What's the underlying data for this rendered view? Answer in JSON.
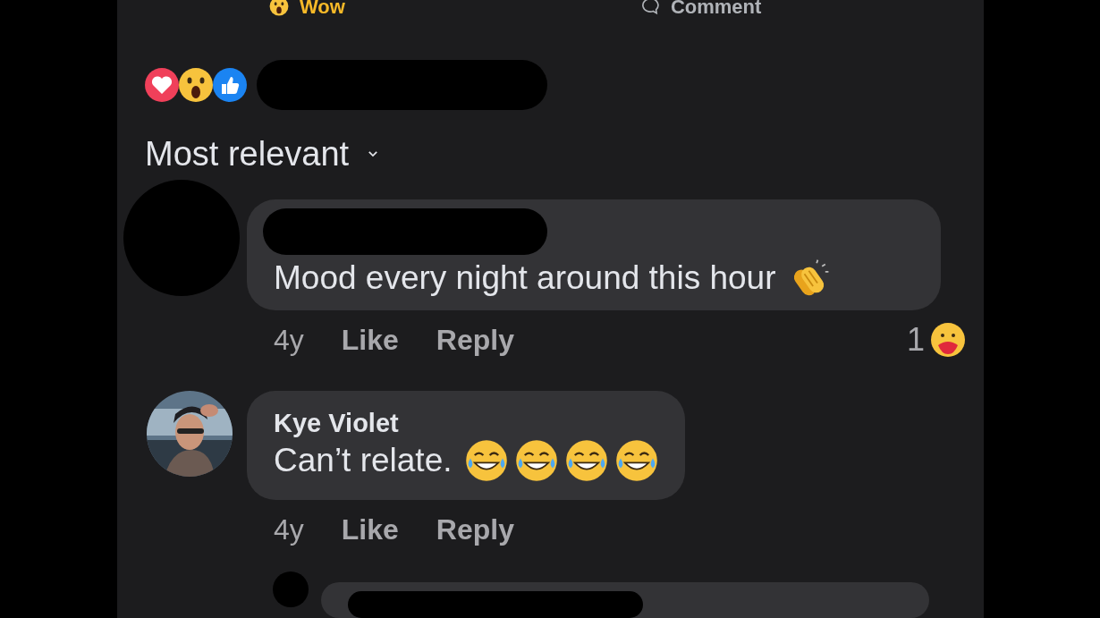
{
  "action_bar": [
    {
      "label": "Wow",
      "kind": "wow",
      "selected": true
    },
    {
      "label": "Comment",
      "kind": "comment",
      "selected": false
    }
  ],
  "reaction_summary": {
    "reactions": [
      {
        "kind": "love"
      },
      {
        "kind": "wow"
      },
      {
        "kind": "like"
      }
    ],
    "names_redacted": true
  },
  "sort": {
    "label": "Most relevant"
  },
  "comments": [
    {
      "author_redacted": true,
      "avatar": {
        "kind": "redacted"
      },
      "text": "Mood every night around this hour",
      "emojis": [
        {
          "kind": "clap"
        }
      ],
      "time": "4y",
      "actions": [
        "Like",
        "Reply"
      ],
      "reaction": {
        "count": "1",
        "kind": "care"
      }
    },
    {
      "author": "Kye Violet",
      "avatar": {
        "kind": "picture"
      },
      "text": "Can’t relate.",
      "emojis": [
        {
          "kind": "laugh"
        },
        {
          "kind": "laugh"
        },
        {
          "kind": "laugh"
        },
        {
          "kind": "laugh"
        }
      ],
      "time": "4y",
      "actions": [
        "Like",
        "Reply"
      ]
    },
    {
      "author_redacted": true,
      "avatar": {
        "kind": "redacted"
      }
    }
  ]
}
